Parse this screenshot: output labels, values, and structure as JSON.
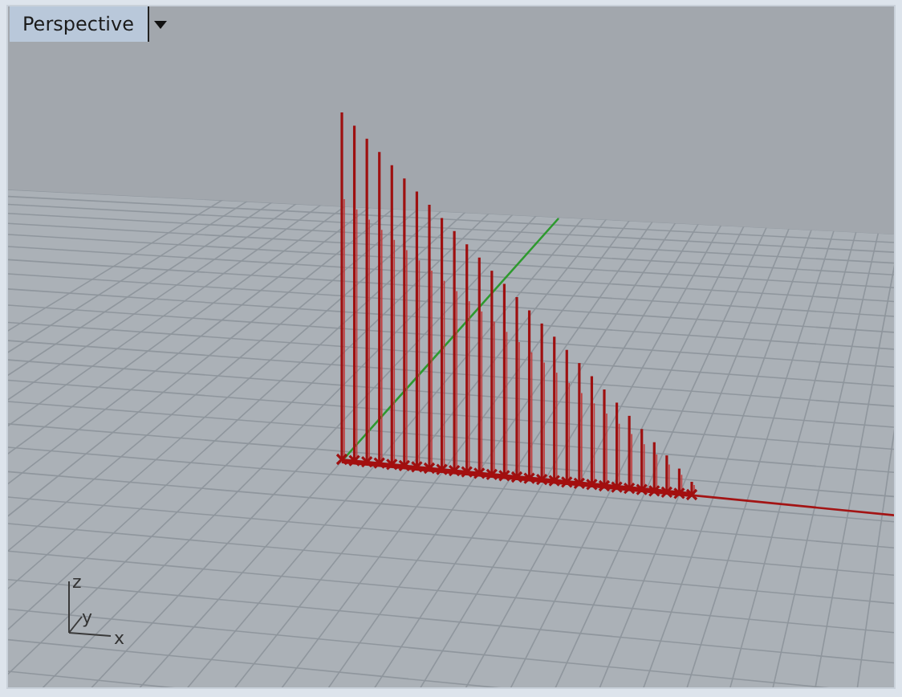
{
  "viewport": {
    "title": "Perspective"
  },
  "axis_labels": [
    "z",
    "y",
    "x"
  ]
}
